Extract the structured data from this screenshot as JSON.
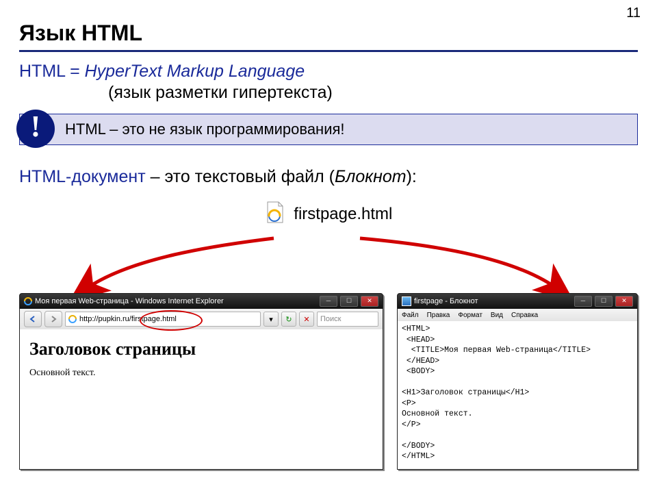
{
  "page_number": "11",
  "title": "Язык HTML",
  "def": {
    "lhs": "HTML = ",
    "rhs": "HyperText Markup Language",
    "sub": "(язык разметки гипертекста)"
  },
  "callout": {
    "bang": "!",
    "text": "HTML – это не язык программирования!"
  },
  "doc_line": {
    "a": "HTML-документ",
    "b": " – это текстовый файл (",
    "c": "Блокнот",
    "d": "):"
  },
  "file_label": "firstpage.html",
  "browser": {
    "title": "Моя первая Web-страница - Windows Internet Explorer",
    "url_prefix": "http://pupkin.ru/firstpage",
    "url_suffix": ".html",
    "search_placeholder": "Поиск",
    "h1": "Заголовок страницы",
    "p": "Основной текст."
  },
  "notepad": {
    "title": "firstpage - Блокнот",
    "menu": [
      "Файл",
      "Правка",
      "Формат",
      "Вид",
      "Справка"
    ],
    "content": "<HTML>\n <HEAD>\n  <TITLE>Моя первая Web-страница</TITLE>\n </HEAD>\n <BODY>\n\n<H1>Заголовок страницы</H1>\n<P>\nОсновной текст.\n</P>\n\n</BODY>\n</HTML>"
  }
}
